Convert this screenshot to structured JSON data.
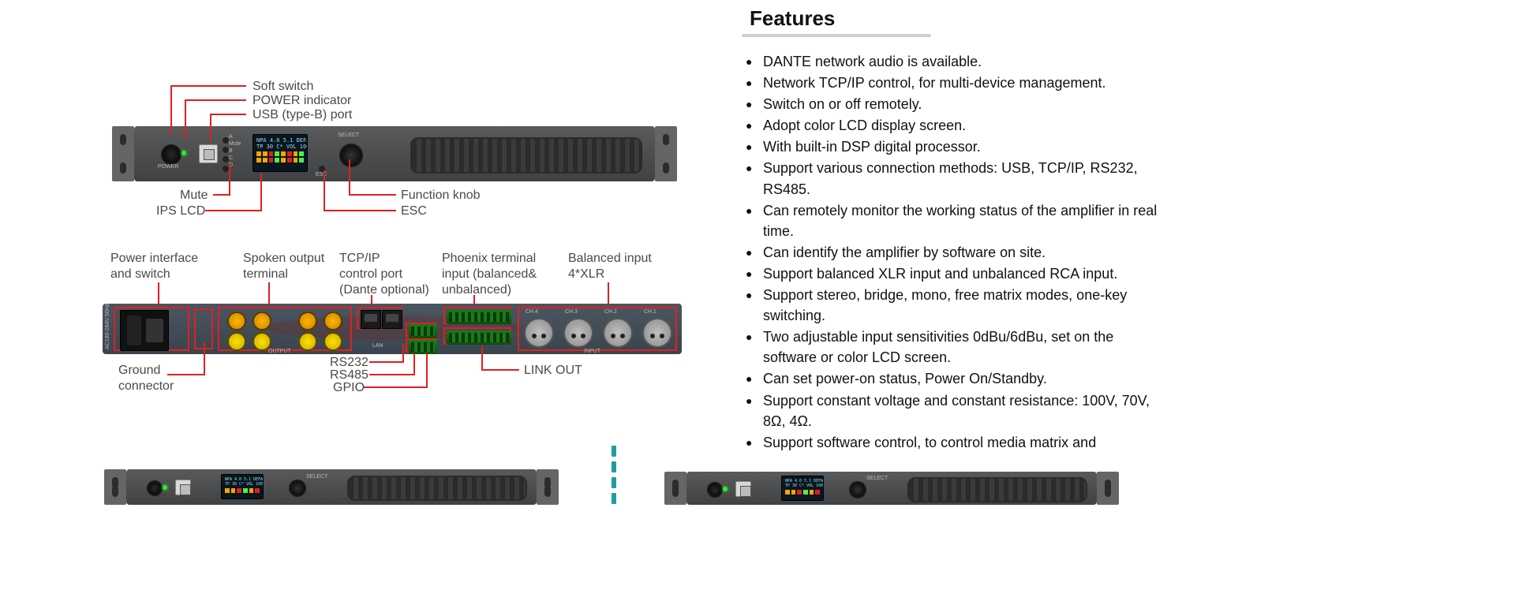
{
  "features": {
    "heading": "Features",
    "items": [
      "DANTE network audio is available.",
      "Network TCP/IP control, for multi-device management.",
      "Switch on or off remotely.",
      "Adopt color LCD display screen.",
      "With built-in DSP digital processor.",
      "Support various connection methods: USB, TCP/IP, RS232, RS485.",
      "Can remotely monitor the working status of the amplifier in real time.",
      "Can identify the amplifier by software on site.",
      "Support balanced XLR input and unbalanced RCA input.",
      "Support stereo, bridge, mono, free matrix modes, one-key switching.",
      "Two adjustable input sensitivities 0dBu/6dBu, set on the software or color LCD screen.",
      "Can set power-on status, Power On/Standby.",
      "Support constant voltage and constant resistance: 100V, 70V, 8Ω, 4Ω.",
      "Support software control, to control media matrix and"
    ]
  },
  "front_panel": {
    "callouts": {
      "soft_switch": "Soft switch",
      "power_indicator": "POWER indicator",
      "usb_port": "USB (type-B) port",
      "mute": "Mute",
      "ips_lcd": "IPS LCD",
      "function_knob": "Function knob",
      "esc": "ESC"
    },
    "lcd_line1": "NPA 4.0 5.1 DEFA",
    "lcd_line2": "TP 30 C* VOL 100",
    "power_label": "POWER",
    "mute_label": "Mute",
    "select_label": "SELECT",
    "esc_label": "ESC",
    "ch": [
      "A",
      "B",
      "C",
      "D"
    ]
  },
  "rear_panel": {
    "callouts": {
      "power_iface": "Power interface\nand switch",
      "spoken_output": "Spoken output\nterminal",
      "tcpip": "TCP/IP\ncontrol port\n(Dante optional)",
      "phoenix": "Phoenix terminal\ninput (balanced&\nunbalanced)",
      "balanced_xlr": "Balanced input\n4*XLR",
      "ground": "Ground\nconnector",
      "rs232": "RS232",
      "rs485": "RS485",
      "gpio": "GPIO",
      "link_out": "LINK OUT"
    },
    "ac_label": "AC180-264V\n50Hz",
    "xlr_ch": [
      "CH.4",
      "CH.3",
      "CH.2",
      "CH.1"
    ],
    "output_label": "OUTPUT",
    "input_label": "INPUT",
    "lan_label": "LAN"
  }
}
